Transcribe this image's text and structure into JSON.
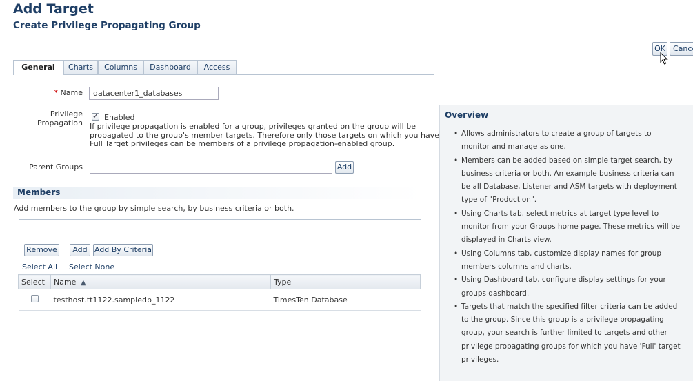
{
  "page": {
    "title": "Add Target",
    "subtitle": "Create Privilege Propagating Group",
    "ok_label": "OK",
    "cancel_label": "Cance"
  },
  "tabs": [
    {
      "label": "General",
      "active": true
    },
    {
      "label": "Charts",
      "active": false
    },
    {
      "label": "Columns",
      "active": false
    },
    {
      "label": "Dashboard",
      "active": false
    },
    {
      "label": "Access",
      "active": false
    }
  ],
  "form": {
    "required_mark": "*",
    "name_label": "Name",
    "name_value": "datacenter1_databases",
    "privilege_label_1": "Privilege",
    "privilege_label_2": "Propagation",
    "enabled_checked": true,
    "enabled_label": "Enabled",
    "propagation_help_1": "If privilege propagation is enabled for a group, privileges granted on the group will be",
    "propagation_help_2": "propagated to the group's member targets. Therefore only those targets on which you have",
    "propagation_help_3": "Full Target privileges can be members of a privilege propagation-enabled group.",
    "parent_groups_label": "Parent Groups",
    "parent_groups_value": "",
    "add_label": "Add"
  },
  "members": {
    "title": "Members",
    "description": "Add members to the group by simple search, by business criteria or both.",
    "remove_label": "Remove",
    "add_label": "Add",
    "add_by_criteria_label": "Add By Criteria",
    "select_all_label": "Select All",
    "select_none_label": "Select None",
    "columns": {
      "select": "Select",
      "name": "Name",
      "type": "Type"
    },
    "sort_indicator": "▲",
    "rows": [
      {
        "selected": false,
        "name": "testhost.tt1122.sampledb_1122",
        "type": "TimesTen Database"
      }
    ]
  },
  "overview": {
    "title": "Overview",
    "items": [
      [
        "Allows administrators to create a group of targets to",
        "monitor and manage as one."
      ],
      [
        "Members can be added based on simple target search, by",
        "business criteria or both. An example business criteria can",
        "be all Database, Listener and ASM targets with deployment",
        "type of \"Production\"."
      ],
      [
        "Using Charts tab, select metrics at target type level to",
        "monitor from your Groups home page. These metrics will be",
        "displayed in Charts view."
      ],
      [
        "Using Columns tab, customize display names for group",
        "members columns and charts."
      ],
      [
        "Using Dashboard tab, configure display settings for your",
        "groups dashboard."
      ],
      [
        "Targets that match the specified filter criteria can be added",
        "to the group. Since this group is a privilege propagating",
        "group, your search is further limited to targets and other",
        "privilege propagating groups for which you have 'Full' target",
        "privileges."
      ]
    ]
  }
}
